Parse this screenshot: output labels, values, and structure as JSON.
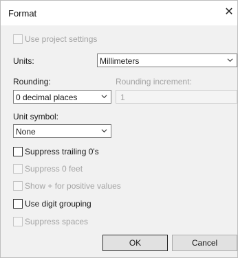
{
  "dialog": {
    "title": "Format",
    "close_glyph": "✕"
  },
  "use_project_settings": {
    "label": "Use project settings",
    "checked": false,
    "enabled": false
  },
  "units": {
    "label": "Units:",
    "value": "Millimeters"
  },
  "rounding": {
    "label": "Rounding:",
    "value": "0 decimal places"
  },
  "rounding_increment": {
    "label": "Rounding increment:",
    "value": "1"
  },
  "unit_symbol": {
    "label": "Unit symbol:",
    "value": "None"
  },
  "options": [
    {
      "label": "Suppress trailing 0's",
      "checked": false,
      "enabled": true
    },
    {
      "label": "Suppress 0 feet",
      "checked": false,
      "enabled": false
    },
    {
      "label": "Show + for positive values",
      "checked": false,
      "enabled": false
    },
    {
      "label": "Use digit grouping",
      "checked": false,
      "enabled": true
    },
    {
      "label": "Suppress spaces",
      "checked": false,
      "enabled": false
    }
  ],
  "buttons": {
    "ok": "OK",
    "cancel": "Cancel"
  },
  "icons": {
    "close": "close-icon",
    "dropdown": "chevron-down-icon"
  }
}
